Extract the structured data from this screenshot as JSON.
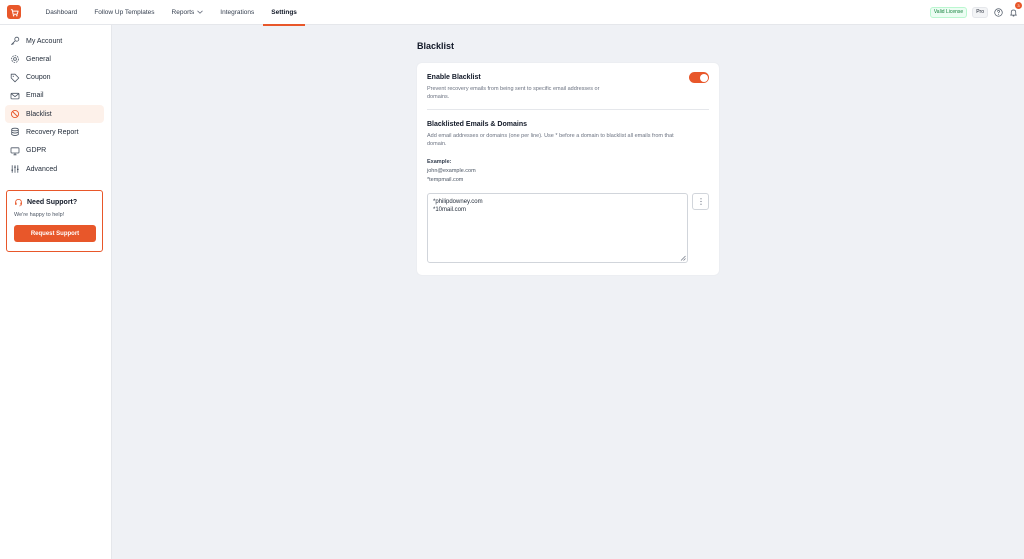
{
  "topbar": {
    "nav": [
      {
        "label": "Dashboard"
      },
      {
        "label": "Follow Up Templates"
      },
      {
        "label": "Reports"
      },
      {
        "label": "Integrations"
      },
      {
        "label": "Settings",
        "active": true
      }
    ],
    "license_badge": "Valid License",
    "plan_badge": "Pro",
    "notification_count": "3"
  },
  "sidebar": {
    "items": [
      {
        "label": "My Account",
        "icon": "key-icon"
      },
      {
        "label": "General",
        "icon": "gear-icon"
      },
      {
        "label": "Coupon",
        "icon": "tag-icon"
      },
      {
        "label": "Email",
        "icon": "mail-icon"
      },
      {
        "label": "Blacklist",
        "icon": "ban-icon",
        "active": true
      },
      {
        "label": "Recovery Report",
        "icon": "database-icon"
      },
      {
        "label": "GDPR",
        "icon": "monitor-icon"
      },
      {
        "label": "Advanced",
        "icon": "sliders-icon"
      }
    ],
    "support": {
      "title": "Need Support?",
      "subtitle": "We're happy to help!",
      "button": "Request Support"
    }
  },
  "main": {
    "title": "Blacklist",
    "enable": {
      "title": "Enable Blacklist",
      "description_line1": "Prevent recovery emails from being sent to specific email addresses or",
      "description_line2": "domains.",
      "enabled": true
    },
    "list": {
      "title": "Blacklisted Emails & Domains",
      "description_line1": "Add email addresses or domains (one per line). Use * before a domain to blacklist all emails from that",
      "description_line2": "domain.",
      "example_label": "Example:",
      "example_lines": [
        "john@example.com",
        "*tempmail.com"
      ],
      "entries": [
        "*philipdowney.com",
        "*10mail.com"
      ]
    }
  },
  "colors": {
    "accent": "#e8572a",
    "background": "#eff1f5"
  }
}
